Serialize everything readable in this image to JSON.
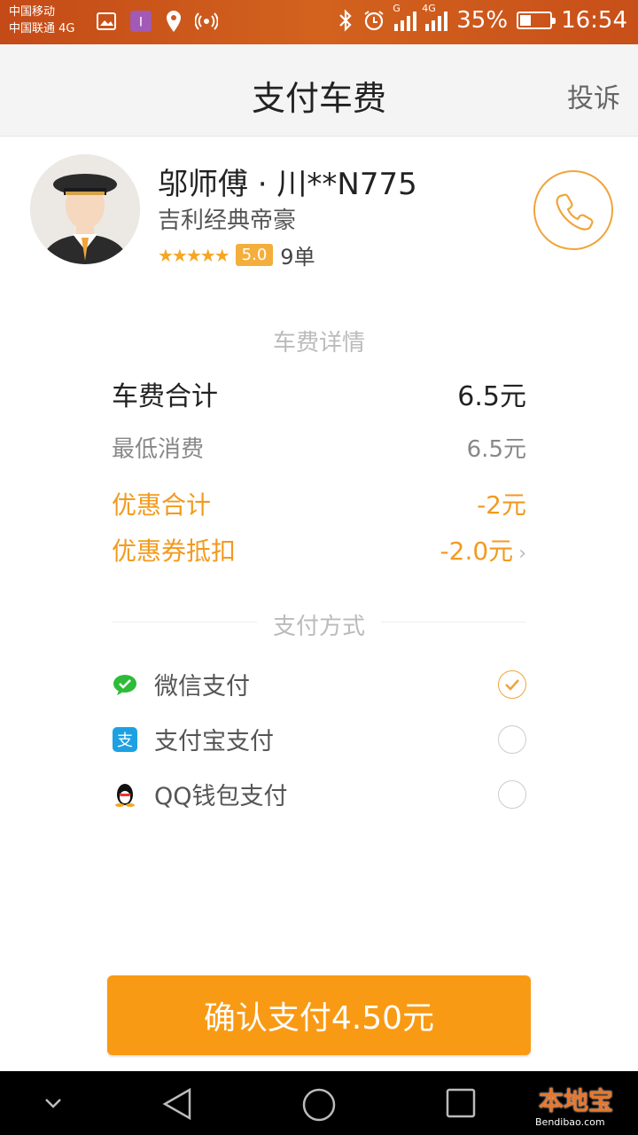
{
  "status_bar": {
    "carrier_1": "中国移动",
    "carrier_2": "中国联通 4G",
    "battery": "35%",
    "time": "16:54",
    "network_1": "G",
    "network_2": "4G"
  },
  "header": {
    "title": "支付车费",
    "complain": "投诉"
  },
  "driver": {
    "name": "邬师傅 · 川**N775",
    "car": "吉利经典帝豪",
    "stars": "★★★★★",
    "score": "5.0",
    "orders": "9单"
  },
  "fare": {
    "section_title": "车费详情",
    "total_label": "车费合计",
    "total_value": "6.5元",
    "min_label": "最低消费",
    "min_value": "6.5元",
    "discount_label": "优惠合计",
    "discount_value": "-2元",
    "coupon_label": "优惠券抵扣",
    "coupon_value": "-2.0元"
  },
  "payment": {
    "section_title": "支付方式",
    "methods": [
      {
        "label": "微信支付",
        "selected": true,
        "icon": "wechat-icon"
      },
      {
        "label": "支付宝支付",
        "selected": false,
        "icon": "alipay-icon"
      },
      {
        "label": "QQ钱包支付",
        "selected": false,
        "icon": "qq-icon"
      }
    ]
  },
  "confirm_button": "确认支付4.50元",
  "watermark": {
    "text": "本地宝",
    "url": "Bendibao.com"
  },
  "colors": {
    "accent": "#f99a14",
    "promo": "#f29a1f",
    "status_bar": "#cc5a1c"
  }
}
